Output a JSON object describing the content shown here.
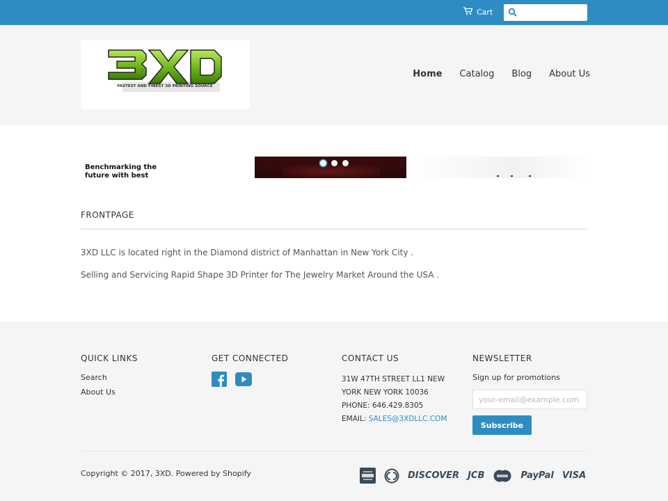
{
  "topbar": {
    "cart_label": "Cart",
    "search_placeholder": "",
    "bg_color": "#2f8cc2"
  },
  "header": {
    "logo_text": "3XD",
    "logo_tagline": "FASTEST AND FINEST 3D PRINTING SOURCE",
    "nav": [
      {
        "label": "Home",
        "active": true
      },
      {
        "label": "Catalog",
        "active": false
      },
      {
        "label": "Blog",
        "active": false
      },
      {
        "label": "About Us",
        "active": false
      }
    ]
  },
  "slider": {
    "caption": "Benchmarking the future with best",
    "slide_count": 3,
    "active_index": 0
  },
  "main": {
    "title": "FRONTPAGE",
    "paragraphs": [
      "3XD LLC  is located right in the Diamond district of Manhattan in New York City .",
      "Selling and Servicing Rapid Shape 3D Printer for The Jewelry Market Around the USA ."
    ]
  },
  "footer": {
    "quick_links": {
      "title": "QUICK LINKS",
      "items": [
        "Search",
        "About Us"
      ]
    },
    "connected": {
      "title": "GET CONNECTED",
      "icons": [
        "facebook-icon",
        "youtube-icon"
      ]
    },
    "contact": {
      "title": "CONTACT US",
      "address_line1": "31W 47TH STREET LL1 NEW",
      "address_line2": "YORK NEW YORK 10036",
      "phone": "PHONE: 646.429.8305",
      "email_label": "EMAIL: ",
      "email": "SALES@3XDLLC.COM"
    },
    "newsletter": {
      "title": "NEWSLETTER",
      "text": "Sign up for promotions",
      "placeholder": "your-email@example.com",
      "button": "Subscribe"
    },
    "copyright": "Copyright © 2017, 3XD.",
    "powered": "Powered by Shopify",
    "payments": [
      "american-express-icon",
      "diners-club-icon",
      "discover-icon",
      "jcb-icon",
      "mastercard-icon",
      "paypal-icon",
      "visa-icon"
    ],
    "payment_labels": {
      "discover": "DISCOVER",
      "jcb": "JCB",
      "paypal": "PayPal",
      "visa": "VISA"
    }
  },
  "colors": {
    "accent": "#2f8cc2",
    "logo_green": "#7ac21e"
  }
}
